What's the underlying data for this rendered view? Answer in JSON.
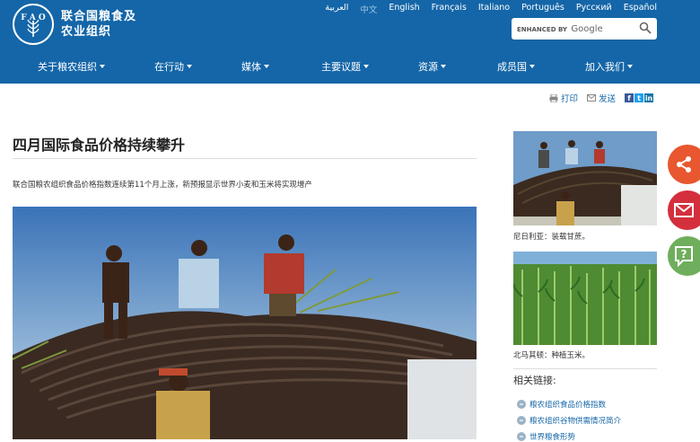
{
  "header": {
    "logo_text_line1": "联合国粮食及",
    "logo_text_line2": "农业组织",
    "languages": [
      {
        "label": "العربية",
        "active": false
      },
      {
        "label": "中文",
        "active": true
      },
      {
        "label": "English",
        "active": false
      },
      {
        "label": "Français",
        "active": false
      },
      {
        "label": "Italiano",
        "active": false
      },
      {
        "label": "Português",
        "active": false
      },
      {
        "label": "Русский",
        "active": false
      },
      {
        "label": "Español",
        "active": false
      }
    ],
    "search": {
      "prefix": "ENHANCED BY",
      "brand": "Google"
    },
    "nav": [
      "关于粮农组织",
      "在行动",
      "媒体",
      "主要议题",
      "资源",
      "成员国",
      "加入我们"
    ]
  },
  "tools": {
    "print": "打印",
    "send": "发送"
  },
  "article": {
    "title": "四月国际食品价格持续攀升",
    "summary": "联合国粮农组织食品价格指数连续第11个月上涨，新预报显示世界小麦和玉米将实现增产"
  },
  "sidebar": {
    "captions": [
      "尼日利亚：装载甘蔗。",
      "北马其顿：种植玉米。"
    ],
    "related_heading": "相关链接:",
    "related_links": [
      "粮农组织食品价格指数",
      "粮农组织谷物供需情况简介",
      "世界粮食形势"
    ]
  },
  "colors": {
    "brand_blue": "#1466a8",
    "share": "#e8572f",
    "mail": "#d42f3c",
    "help": "#6fae5c"
  }
}
